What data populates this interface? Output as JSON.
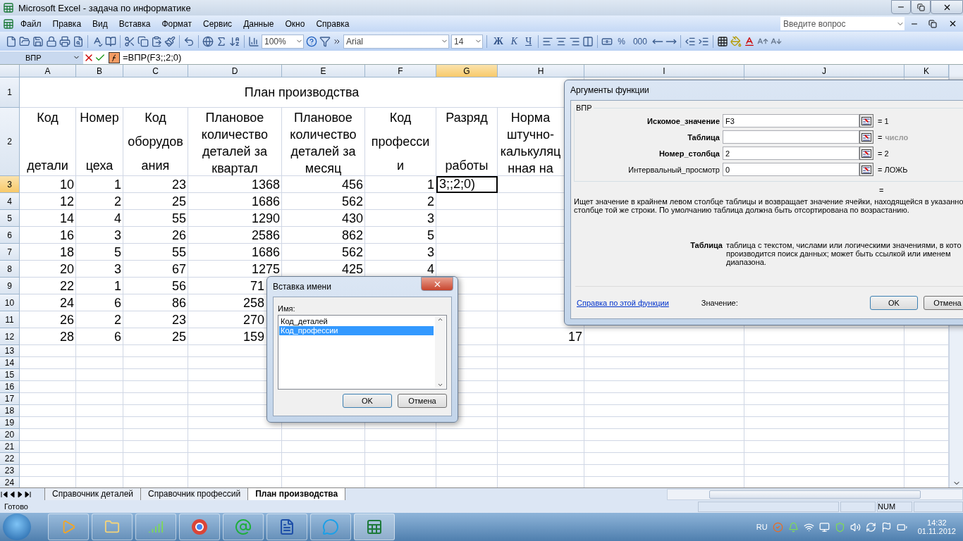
{
  "window": {
    "title": "Microsoft Excel - задача по информатике"
  },
  "menu": [
    "Файл",
    "Правка",
    "Вид",
    "Вставка",
    "Формат",
    "Сервис",
    "Данные",
    "Окно",
    "Справка"
  ],
  "help_box": {
    "placeholder": "Введите вопрос"
  },
  "toolbar": {
    "zoom": "100%",
    "font": "Arial",
    "font_size": "14",
    "style_buttons": [
      "Ж",
      "К",
      "Ч"
    ],
    "number_buttons": [
      "%",
      "000"
    ]
  },
  "formula_bar": {
    "name_box": "ВПР",
    "formula": "=ВПР(F3;;2;0)"
  },
  "sheet": {
    "columns": [
      {
        "label": "A",
        "selected": false
      },
      {
        "label": "B",
        "selected": false
      },
      {
        "label": "C",
        "selected": false
      },
      {
        "label": "D",
        "selected": false
      },
      {
        "label": "E",
        "selected": false
      },
      {
        "label": "F",
        "selected": false
      },
      {
        "label": "G",
        "selected": true
      },
      {
        "label": "H",
        "selected": false
      },
      {
        "label": "I",
        "selected": false
      },
      {
        "label": "J",
        "selected": false
      },
      {
        "label": "K",
        "selected": false
      }
    ],
    "row_numbers": [
      {
        "label": "1",
        "selected": false
      },
      {
        "label": "2",
        "selected": false
      },
      {
        "label": "3",
        "selected": true
      },
      {
        "label": "4",
        "selected": false
      },
      {
        "label": "5",
        "selected": false
      },
      {
        "label": "6",
        "selected": false
      },
      {
        "label": "7",
        "selected": false
      },
      {
        "label": "8",
        "selected": false
      },
      {
        "label": "9",
        "selected": false
      },
      {
        "label": "10",
        "selected": false
      },
      {
        "label": "11",
        "selected": false
      },
      {
        "label": "12",
        "selected": false
      },
      {
        "label": "13",
        "selected": false
      },
      {
        "label": "14",
        "selected": false
      },
      {
        "label": "15",
        "selected": false
      },
      {
        "label": "16",
        "selected": false
      },
      {
        "label": "17",
        "selected": false
      },
      {
        "label": "18",
        "selected": false
      },
      {
        "label": "19",
        "selected": false
      },
      {
        "label": "20",
        "selected": false
      },
      {
        "label": "21",
        "selected": false
      },
      {
        "label": "22",
        "selected": false
      },
      {
        "label": "23",
        "selected": false
      },
      {
        "label": "24",
        "selected": false
      }
    ],
    "title": "План производства",
    "headers": [
      [
        "Код",
        "детали"
      ],
      [
        "Номер",
        "цеха"
      ],
      [
        "Код",
        "оборудов",
        "ания"
      ],
      [
        "Плановое",
        "количество",
        "деталей за",
        "квартал"
      ],
      [
        "Плановое",
        "количество",
        "деталей за",
        "месяц"
      ],
      [
        "Код",
        "професси",
        "и"
      ],
      [
        "Разряд",
        "работы"
      ],
      [
        "Норма",
        "штучно-",
        "калькуляц",
        "нная на"
      ]
    ],
    "rows": [
      {
        "A": "10",
        "B": "1",
        "C": "23",
        "D": {
          "text": "1368",
          "cut": false
        },
        "E": "456",
        "F": "1",
        "G": {
          "text": "3;;2;0)",
          "selected": true
        }
      },
      {
        "A": "12",
        "B": "2",
        "C": "25",
        "D": {
          "text": "1686",
          "cut": false
        },
        "E": "562",
        "F": "2"
      },
      {
        "A": "14",
        "B": "4",
        "C": "55",
        "D": {
          "text": "1290",
          "cut": false
        },
        "E": "430",
        "F": "3"
      },
      {
        "A": "16",
        "B": "3",
        "C": "26",
        "D": {
          "text": "2586",
          "cut": false
        },
        "E": "862",
        "F": "5"
      },
      {
        "A": "18",
        "B": "5",
        "C": "55",
        "D": {
          "text": "1686",
          "cut": false
        },
        "E": "562",
        "F": "3"
      },
      {
        "A": "20",
        "B": "3",
        "C": "67",
        "D": {
          "text": "1275",
          "cut": false
        },
        "E": "425",
        "F": "4"
      },
      {
        "A": "22",
        "B": "1",
        "C": "56",
        "D": {
          "text": "71",
          "cut": true
        }
      },
      {
        "A": "24",
        "B": "6",
        "C": "86",
        "D": {
          "text": "258",
          "cut": true
        }
      },
      {
        "A": "26",
        "B": "2",
        "C": "23",
        "D": {
          "text": "270",
          "cut": true
        }
      },
      {
        "A": "28",
        "B": "6",
        "C": "25",
        "D": {
          "text": "159",
          "cut": true
        },
        "H": "17"
      }
    ]
  },
  "tabs": [
    {
      "label": "Справочник деталей",
      "selected": false
    },
    {
      "label": "Справочник профессий",
      "selected": false
    },
    {
      "label": "План производства",
      "selected": true
    }
  ],
  "status_bar": {
    "text": "Готово",
    "indicators": [
      "NUM"
    ]
  },
  "function_dialog": {
    "title": "Аргументы функции",
    "function": "ВПР",
    "arguments": [
      {
        "label": "Искомое_значение",
        "required": true,
        "value": "F3",
        "result": "= 1"
      },
      {
        "label": "Таблица",
        "required": true,
        "result": "=",
        "result_faint": "число"
      },
      {
        "label": "Номер_столбца",
        "required": true,
        "value": "2",
        "result": "= 2"
      },
      {
        "label": "Интервальный_просмотр",
        "required": false,
        "value": "0",
        "result": "= ЛОЖЬ"
      }
    ],
    "formula_result": "=",
    "description_lines": [
      "Ищет значение в крайнем левом столбце таблицы и возвращает значение ячейки, находящейся в указанно",
      "столбце той же строки. По умолчанию таблица должна быть отсортирована по возрастанию."
    ],
    "argument_name": "Таблица",
    "argument_help_lines": [
      "таблица с текстом, числами или логическими значениями, в кото",
      "производится поиск данных; может быть ссылкой или именем",
      "диапазона."
    ],
    "help_link": "Справка по этой функции",
    "value_label": "Значение:",
    "buttons": [
      "OK",
      "Отмена"
    ]
  },
  "name_dialog": {
    "title": "Вставка имени",
    "label": "Имя:",
    "items": [
      {
        "label": "Код_деталей",
        "selected": false
      },
      {
        "label": "Код_профессии",
        "selected": true
      }
    ],
    "buttons": [
      "OK",
      "Отмена"
    ]
  },
  "taskbar": {
    "language": "RU",
    "time": "14:32",
    "date": "01.11.2012"
  }
}
